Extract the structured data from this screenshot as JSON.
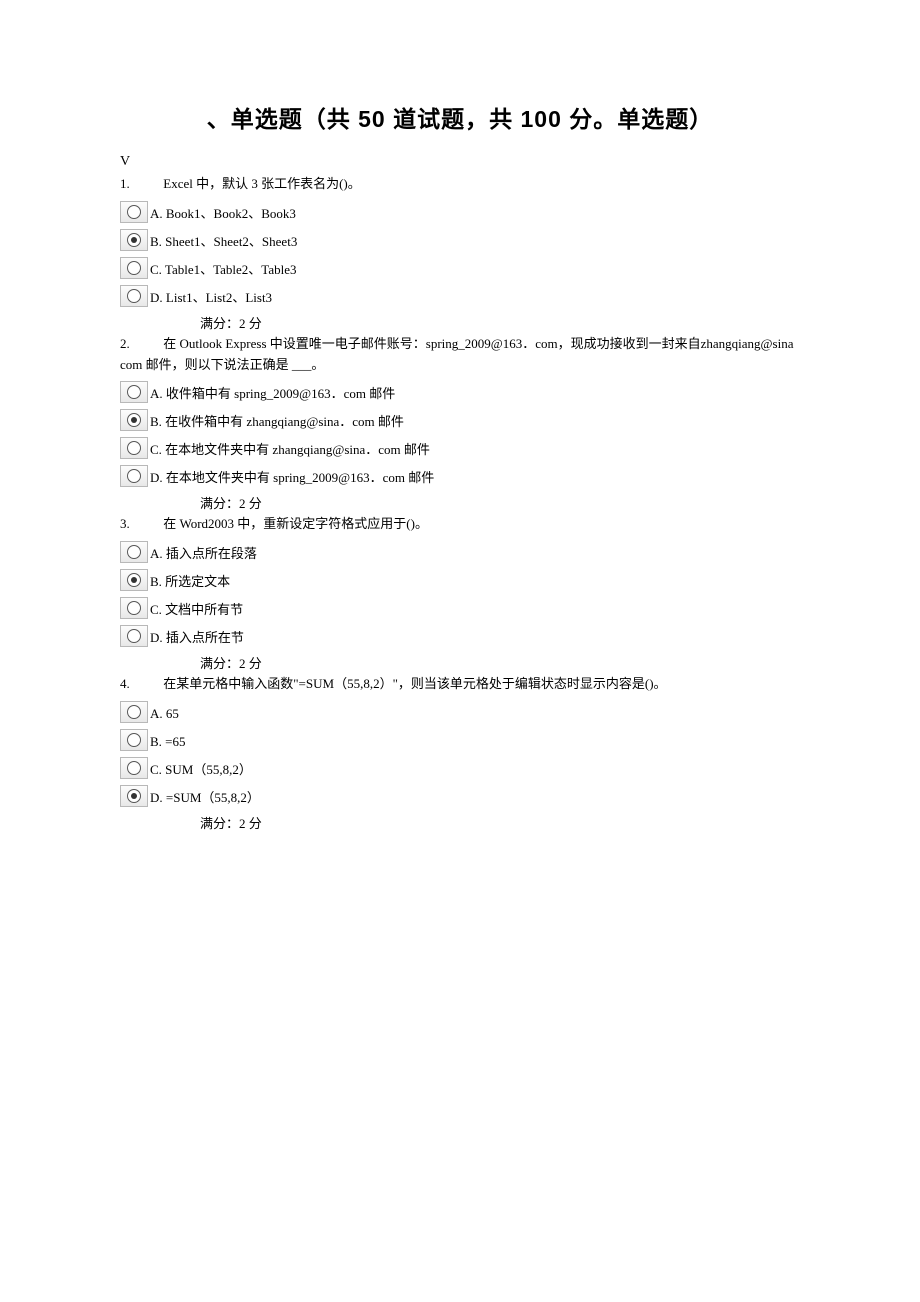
{
  "title": "、单选题（共  50  道试题，共  100  分。单选题）",
  "intro": "V",
  "score_label": "满分：2    分",
  "questions": [
    {
      "num": "1.",
      "text": "Excel 中，默认 3 张工作表名为()。",
      "options": [
        {
          "label": "A. Book1、Book2、Book3",
          "selected": false
        },
        {
          "label": "B. Sheet1、Sheet2、Sheet3",
          "selected": true
        },
        {
          "label": "C. Table1、Table2、Table3",
          "selected": false
        },
        {
          "label": "D. List1、List2、List3",
          "selected": false
        }
      ]
    },
    {
      "num": "2.",
      "text": "在 Outlook Express 中设置唯一电子邮件账号：spring_2009@163．com，现成功接收到一封来自zhangqiang@sina com 邮件，则以下说法正确是 ___。",
      "options": [
        {
          "label": "A. 收件箱中有 spring_2009@163．com 邮件",
          "selected": false
        },
        {
          "label": "B. 在收件箱中有 zhangqiang@sina．com 邮件",
          "selected": true
        },
        {
          "label": "C. 在本地文件夹中有 zhangqiang@sina．com 邮件",
          "selected": false
        },
        {
          "label": "D. 在本地文件夹中有 spring_2009@163．com 邮件",
          "selected": false
        }
      ]
    },
    {
      "num": "3.",
      "text": "在 Word2003 中，重新设定字符格式应用于()。",
      "options": [
        {
          "label": "A. 插入点所在段落",
          "selected": false
        },
        {
          "label": "B. 所选定文本",
          "selected": true
        },
        {
          "label": "C. 文档中所有节",
          "selected": false
        },
        {
          "label": "D. 插入点所在节",
          "selected": false
        }
      ]
    },
    {
      "num": "4.",
      "text": "在某单元格中输入函数\"=SUM（55,8,2）\"，则当该单元格处于编辑状态时显示内容是()。",
      "options": [
        {
          "label": "A. 65",
          "selected": false
        },
        {
          "label": "B. =65",
          "selected": false
        },
        {
          "label": "C. SUM（55,8,2）",
          "selected": false
        },
        {
          "label": "D. =SUM（55,8,2）",
          "selected": true
        }
      ]
    }
  ]
}
